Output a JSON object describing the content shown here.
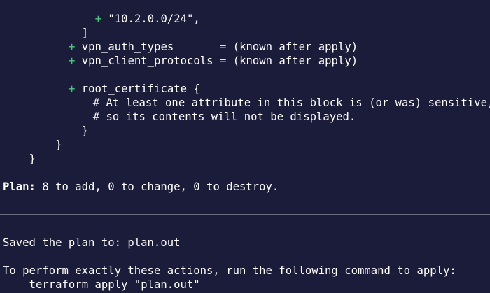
{
  "colors": {
    "background": "#1b1b3a",
    "text": "#ffffff",
    "plus_marker": "#3fd07a",
    "divider": "#6a6a80"
  },
  "plan_block": {
    "plus_marker": "+",
    "cidr_value": "\"10.2.0.0/24\",",
    "close_bracket": "]",
    "vpn_auth_types": {
      "name": "vpn_auth_types",
      "value": "= (known after apply)"
    },
    "vpn_client_protocols": {
      "name": "vpn_client_protocols",
      "value": "= (known after apply)"
    },
    "root_certificate": {
      "header": "root_certificate {",
      "comment_1": "# At least one attribute in this block is (or was) sensitive,",
      "comment_2": "# so its contents will not be displayed."
    },
    "close_brace": "}"
  },
  "summary": {
    "label": "Plan:",
    "text": "8 to add, 0 to change, 0 to destroy."
  },
  "saved": {
    "text": "Saved the plan to: plan.out"
  },
  "instructions": {
    "text": "To perform exactly these actions, run the following command to apply:",
    "command": "terraform apply \"plan.out\""
  }
}
